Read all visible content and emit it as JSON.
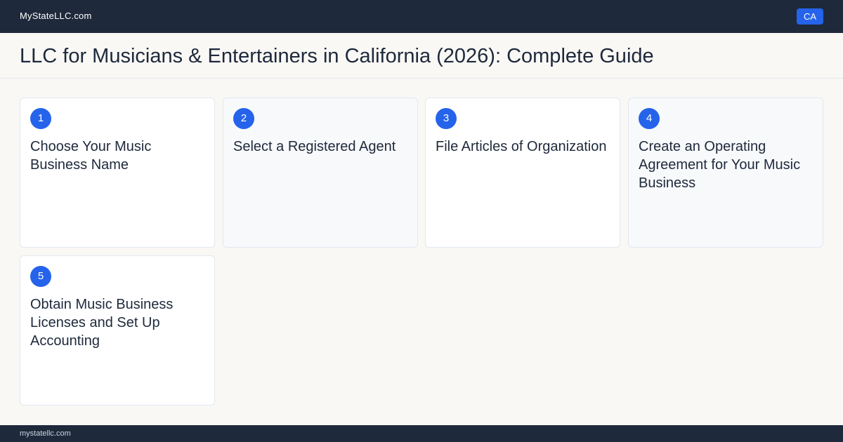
{
  "header": {
    "brand": "MyStateLLC.com",
    "state_badge": "CA"
  },
  "page": {
    "title": "LLC for Musicians & Entertainers in California (2026): Complete Guide"
  },
  "steps": [
    {
      "number": "1",
      "title": "Choose Your Music Business Name"
    },
    {
      "number": "2",
      "title": "Select a Registered Agent"
    },
    {
      "number": "3",
      "title": "File Articles of Organization"
    },
    {
      "number": "4",
      "title": "Create an Operating Agreement for Your Music Business"
    },
    {
      "number": "5",
      "title": "Obtain Music Business Licenses and Set Up Accounting"
    }
  ],
  "footer": {
    "domain": "mystatellc.com"
  },
  "colors": {
    "navy": "#1e293b",
    "accent": "#2563eb",
    "background": "#f9f8f5"
  }
}
